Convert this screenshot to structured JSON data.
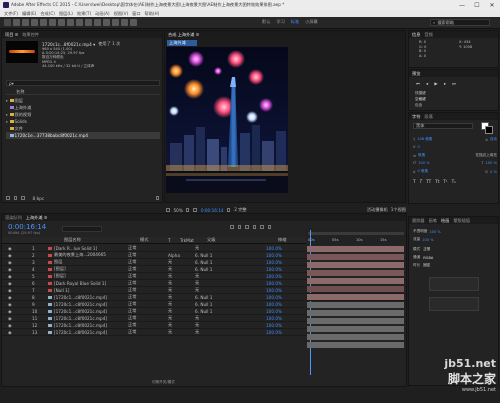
{
  "window": {
    "title": "Adobe After Effects CC 2015 - C:\\Users\\wei\\Desktop\\国字体在(AE)制作上海夜景大图\\上海夜景大图\\AE制作上海夜景大图特效效果排图.aep *",
    "minimize": "—",
    "maximize": "☐",
    "close": "✕"
  },
  "menu": [
    "文件(F)",
    "编辑(E)",
    "合成(C)",
    "图层(L)",
    "效果(T)",
    "动画(A)",
    "视图(V)",
    "窗口",
    "帮助(H)"
  ],
  "toolbar": {
    "workspaces": [
      "默认",
      "学习",
      "标准",
      "小屏幕"
    ],
    "search_placeholder": "搜索帮助"
  },
  "project": {
    "tab": "项目 ≡",
    "effects_tab": "效果控件",
    "selected_name": "1720c1c...8f0021c.mp4 ▾",
    "used_count": "使用了 1 次",
    "info_lines": [
      "960 x 540 (1.00)",
      "Δ 0;00;14;25, 29.97 fps",
      "数百万种颜色",
      "MPEG 4",
      "44.100 kHz / 32 bit U / 立体声"
    ],
    "search_placeholder": "ρ▾",
    "col_name": "名称",
    "items": [
      {
        "name": "图层",
        "color": "#d9b23a"
      },
      {
        "name": "上海外滩",
        "color": "#9b7fd0"
      },
      {
        "name": "我的视频",
        "color": "#d9b23a"
      },
      {
        "name": "Solids",
        "color": "#d9b23a"
      },
      {
        "name": "文件",
        "color": "#d9b23a"
      },
      {
        "name": "1720c1e...37738babc8f0021c.mp4",
        "color": "#9ab8c8"
      }
    ],
    "bpc": "8 bpc"
  },
  "composition": {
    "tab": "合成 上海外滩 ≡",
    "sub_tab": "上海外滩",
    "zoom": "50%",
    "timecode": "0:00:16:14",
    "camera": "活动摄像机",
    "views": "1个视图",
    "rendered_by": "2 完整"
  },
  "right_panel": {
    "tabs": [
      "信息",
      "音频"
    ],
    "rgba": [
      "R: 0",
      "G: 0",
      "B: 0",
      "A: 0"
    ],
    "coords": [
      "X: 434",
      "Y: 1058"
    ],
    "preview_tab": "预览",
    "shortcut_label": "快捷键",
    "shortcut_value": "空格键",
    "include_label": "包含",
    "fonts_tab": "字符",
    "para_tab": "段落",
    "font_name": "黑体",
    "font_size": "108 像素",
    "leading": "自动",
    "tracking": "0",
    "stroke": "像素",
    "stroke_fill": "在描边上填充",
    "scale_h": "100 %",
    "scale_v": "100 %",
    "baseline": "0 像素",
    "tsume": "0 %",
    "style_buttons": [
      "T",
      "T",
      "TT",
      "Tt",
      "T¹",
      "T₁"
    ],
    "lower_tabs": [
      "跟踪器",
      "画笔",
      "绘画",
      "蒙版插值"
    ],
    "paint_opacity_label": "不透明度",
    "paint_opacity": "100 %",
    "paint_flow_label": "流量",
    "paint_flow": "100 %",
    "paint_mode_label": "模式",
    "paint_mode": "正常",
    "paint_channel_label": "通道",
    "paint_channel": "RGBA",
    "paint_duration_label": "时长",
    "paint_duration": "固定"
  },
  "timeline": {
    "tab_render": "渲染队列",
    "tab_comp": "上海外滩 ≡",
    "timecode": "0:00:16:14",
    "fps_hint": "00494 (29.97 fps)",
    "columns": {
      "source": "图层名称",
      "mode": "模式",
      "t": "T",
      "trkmat": "TrkMat",
      "parent": "父级",
      "stretch": "伸缩"
    },
    "ruler": [
      "00s",
      "05s",
      "10s",
      "15s"
    ],
    "toggle_label": "切换开关/模式",
    "layers": [
      {
        "num": "1",
        "color": "#c94a4a",
        "name": "[Dark R...lue Solid 1]",
        "mode": "正常",
        "trkmat": "",
        "parent": "无",
        "stretch": "100.0%",
        "bar": "#8c6a6a"
      },
      {
        "num": "2",
        "color": "#c94a4a",
        "name": "最美的夜景上海...2004665",
        "mode": "正常",
        "trkmat": "Alpha",
        "parent": "6. Null 1",
        "stretch": "100.0%",
        "bar": "#7a5858"
      },
      {
        "num": "3",
        "color": "#c94a4a",
        "name": "图层",
        "mode": "正常",
        "trkmat": "无",
        "parent": "6. Null 1",
        "stretch": "100.0%",
        "bar": "#8c6a6a"
      },
      {
        "num": "4",
        "color": "#c94a4a",
        "name": "[图层]",
        "mode": "正常",
        "trkmat": "无",
        "parent": "6. Null 1",
        "stretch": "100.0%",
        "bar": "#7a5858"
      },
      {
        "num": "5",
        "color": "#c94a4a",
        "name": "[图层]",
        "mode": "正常",
        "trkmat": "无",
        "parent": "无",
        "stretch": "100.0%",
        "bar": "#8c6a6a"
      },
      {
        "num": "6",
        "color": "#c94a4a",
        "name": "[Dark Royal Blue Solid 1]",
        "mode": "正常",
        "trkmat": "无",
        "parent": "无",
        "stretch": "100.0%",
        "bar": "#6e5050"
      },
      {
        "num": "7",
        "color": "#c94a4a",
        "name": "[Null 1]",
        "mode": "正常",
        "trkmat": "无",
        "parent": "无",
        "stretch": "100.0%",
        "bar": "#8c6a6a"
      },
      {
        "num": "8",
        "color": "#8fb0c8",
        "name": "[1720c1...c8f0021c.mp4]",
        "mode": "正常",
        "trkmat": "无",
        "parent": "6. Null 1",
        "stretch": "100.0%",
        "bar": "#6a6a6a"
      },
      {
        "num": "9",
        "color": "#8fb0c8",
        "name": "[1720c1...c8f0021c.mp4]",
        "mode": "正常",
        "trkmat": "无",
        "parent": "6. Null 1",
        "stretch": "100.0%",
        "bar": "#6a6a6a"
      },
      {
        "num": "10",
        "color": "#8fb0c8",
        "name": "[1720c1...c8f0021c.mp4]",
        "mode": "正常",
        "trkmat": "无",
        "parent": "6. Null 1",
        "stretch": "100.0%",
        "bar": "#6a6a6a"
      },
      {
        "num": "11",
        "color": "#8fb0c8",
        "name": "[1720c1...c8f0021c.mp4]",
        "mode": "正常",
        "trkmat": "无",
        "parent": "无",
        "stretch": "100.0%",
        "bar": "#6a6a6a"
      },
      {
        "num": "12",
        "color": "#8fb0c8",
        "name": "[1720c1...c8f0021c.mp4]",
        "mode": "正常",
        "trkmat": "无",
        "parent": "无",
        "stretch": "100.0%",
        "bar": "#6a6a6a"
      },
      {
        "num": "13",
        "color": "#8fb0c8",
        "name": "[1720c1...c8f0021c.mp4]",
        "mode": "正常",
        "trkmat": "无",
        "parent": "无",
        "stretch": "100.0%",
        "bar": "#6a6a6a"
      }
    ]
  },
  "watermark": {
    "site": "jb51.net",
    "brand": "脚本之家",
    "url": "www.jb51.net"
  }
}
